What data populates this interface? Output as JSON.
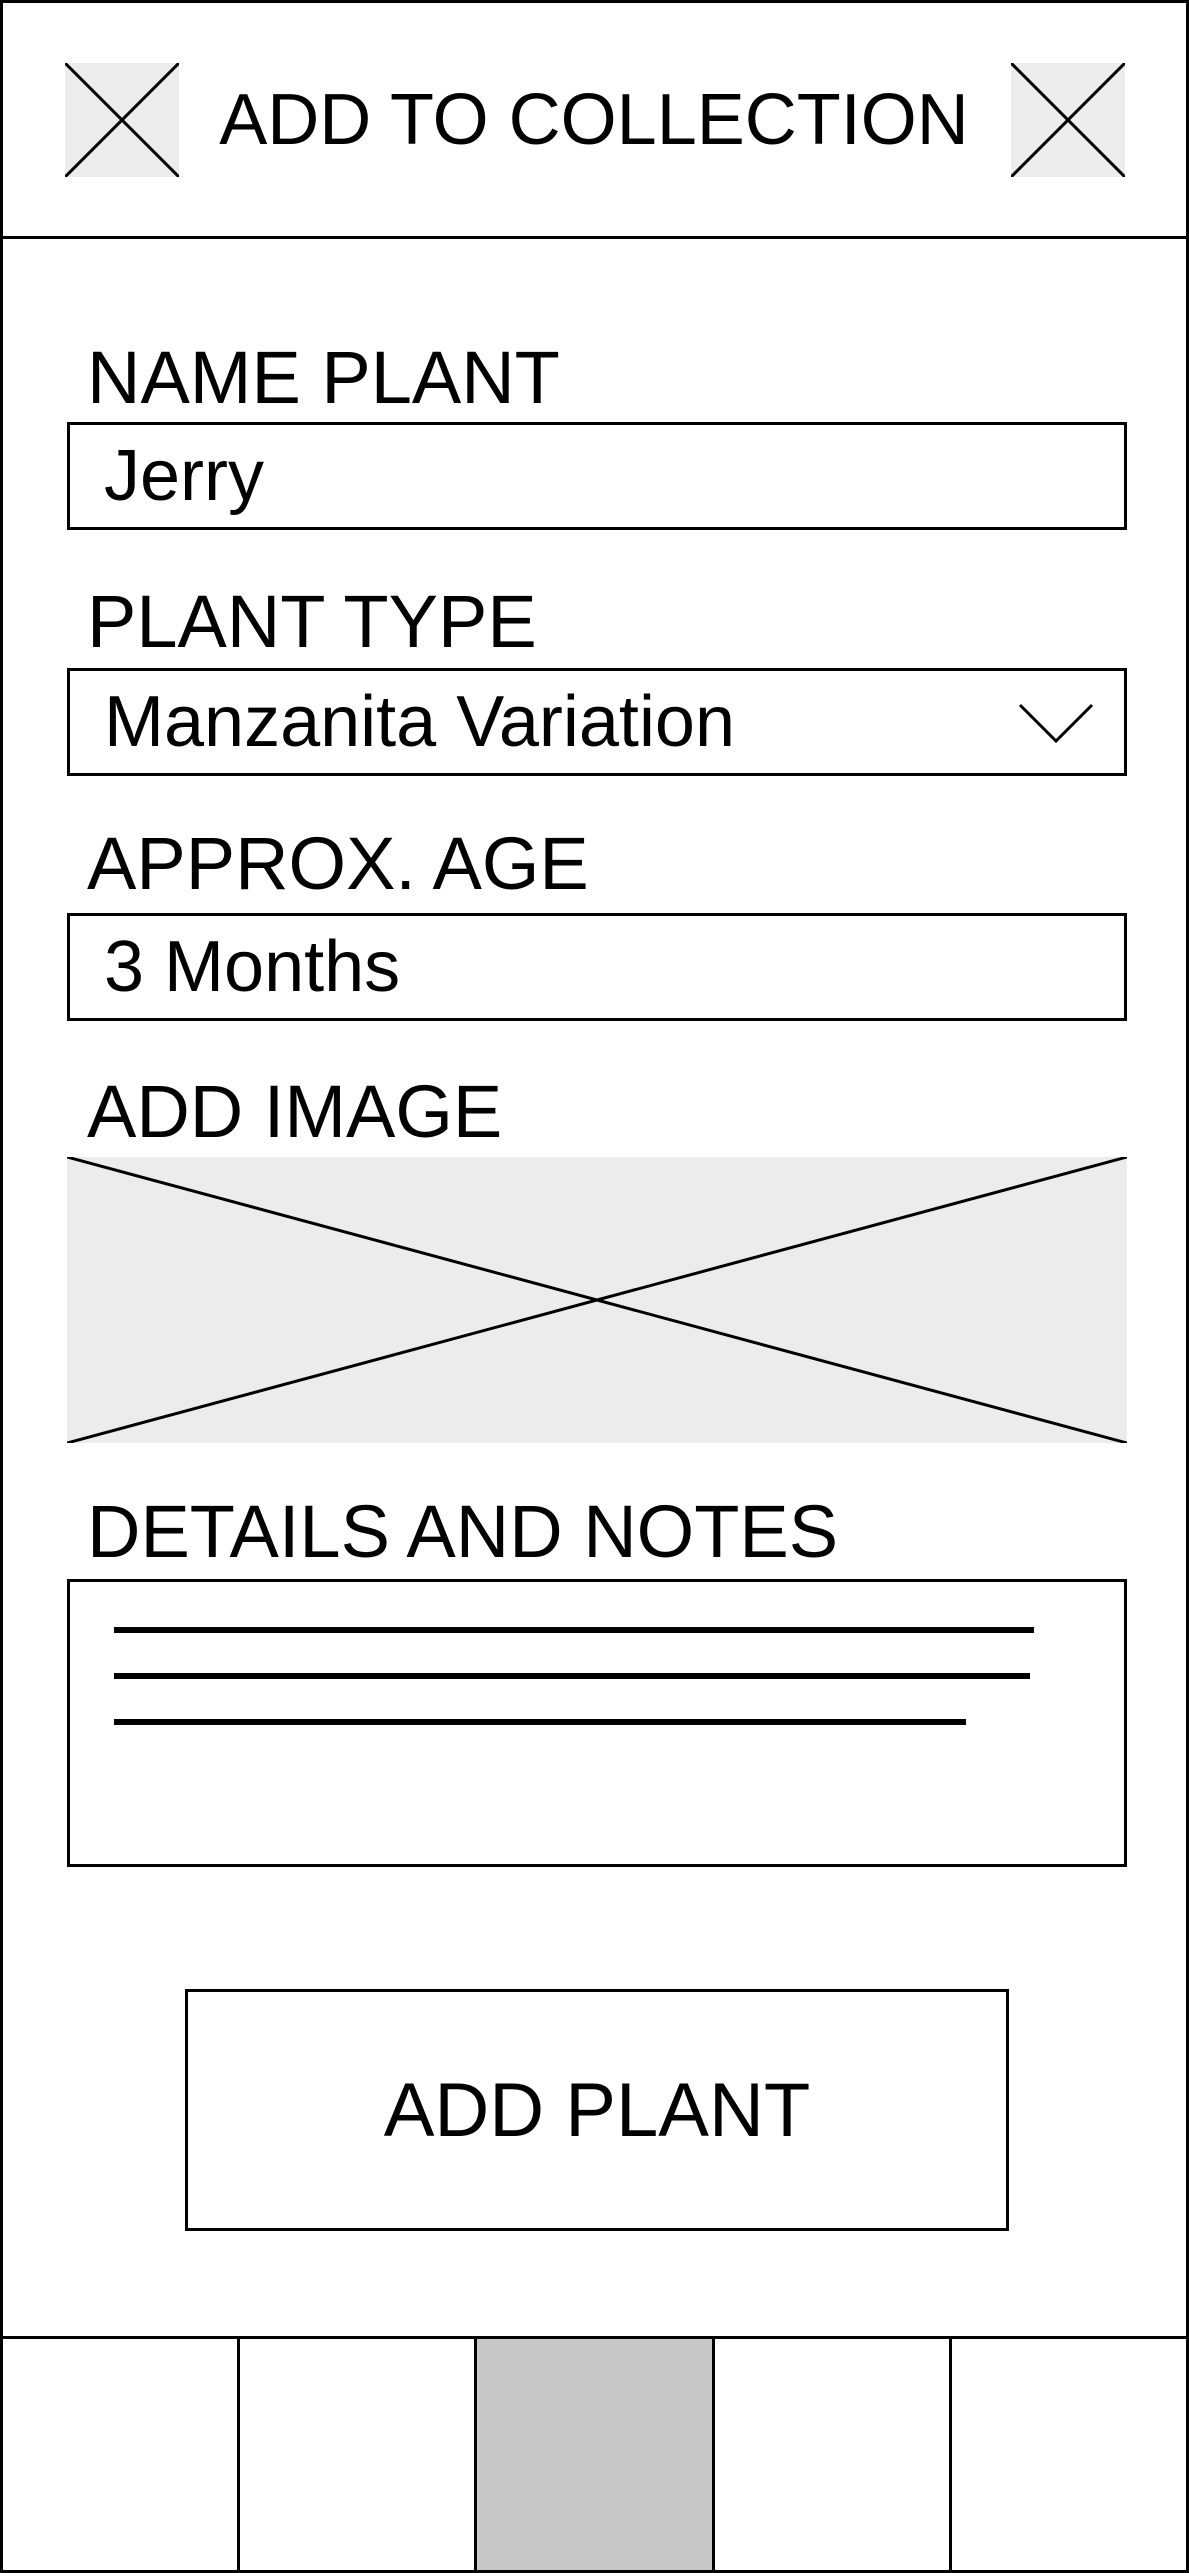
{
  "header": {
    "title": "ADD TO COLLECTION",
    "left_icon": "close-placeholder-icon",
    "right_icon": "close-placeholder-icon"
  },
  "form": {
    "name": {
      "label": "NAME PLANT",
      "value": "Jerry"
    },
    "type": {
      "label": "PLANT TYPE",
      "value": "Manzanita Variation",
      "dropdown_icon": "chevron-down-icon"
    },
    "age": {
      "label": "APPROX. AGE",
      "value": "3 Months"
    },
    "image": {
      "label": "ADD IMAGE"
    },
    "notes": {
      "label": "DETAILS AND NOTES"
    }
  },
  "submit": {
    "label": "ADD PLANT"
  },
  "navbar": {
    "item_count": 5,
    "active_index": 2
  },
  "colors": {
    "border": "#000000",
    "background": "#ffffff",
    "placeholder_fill": "#ececec",
    "active_tab": "#c8c8c8"
  }
}
